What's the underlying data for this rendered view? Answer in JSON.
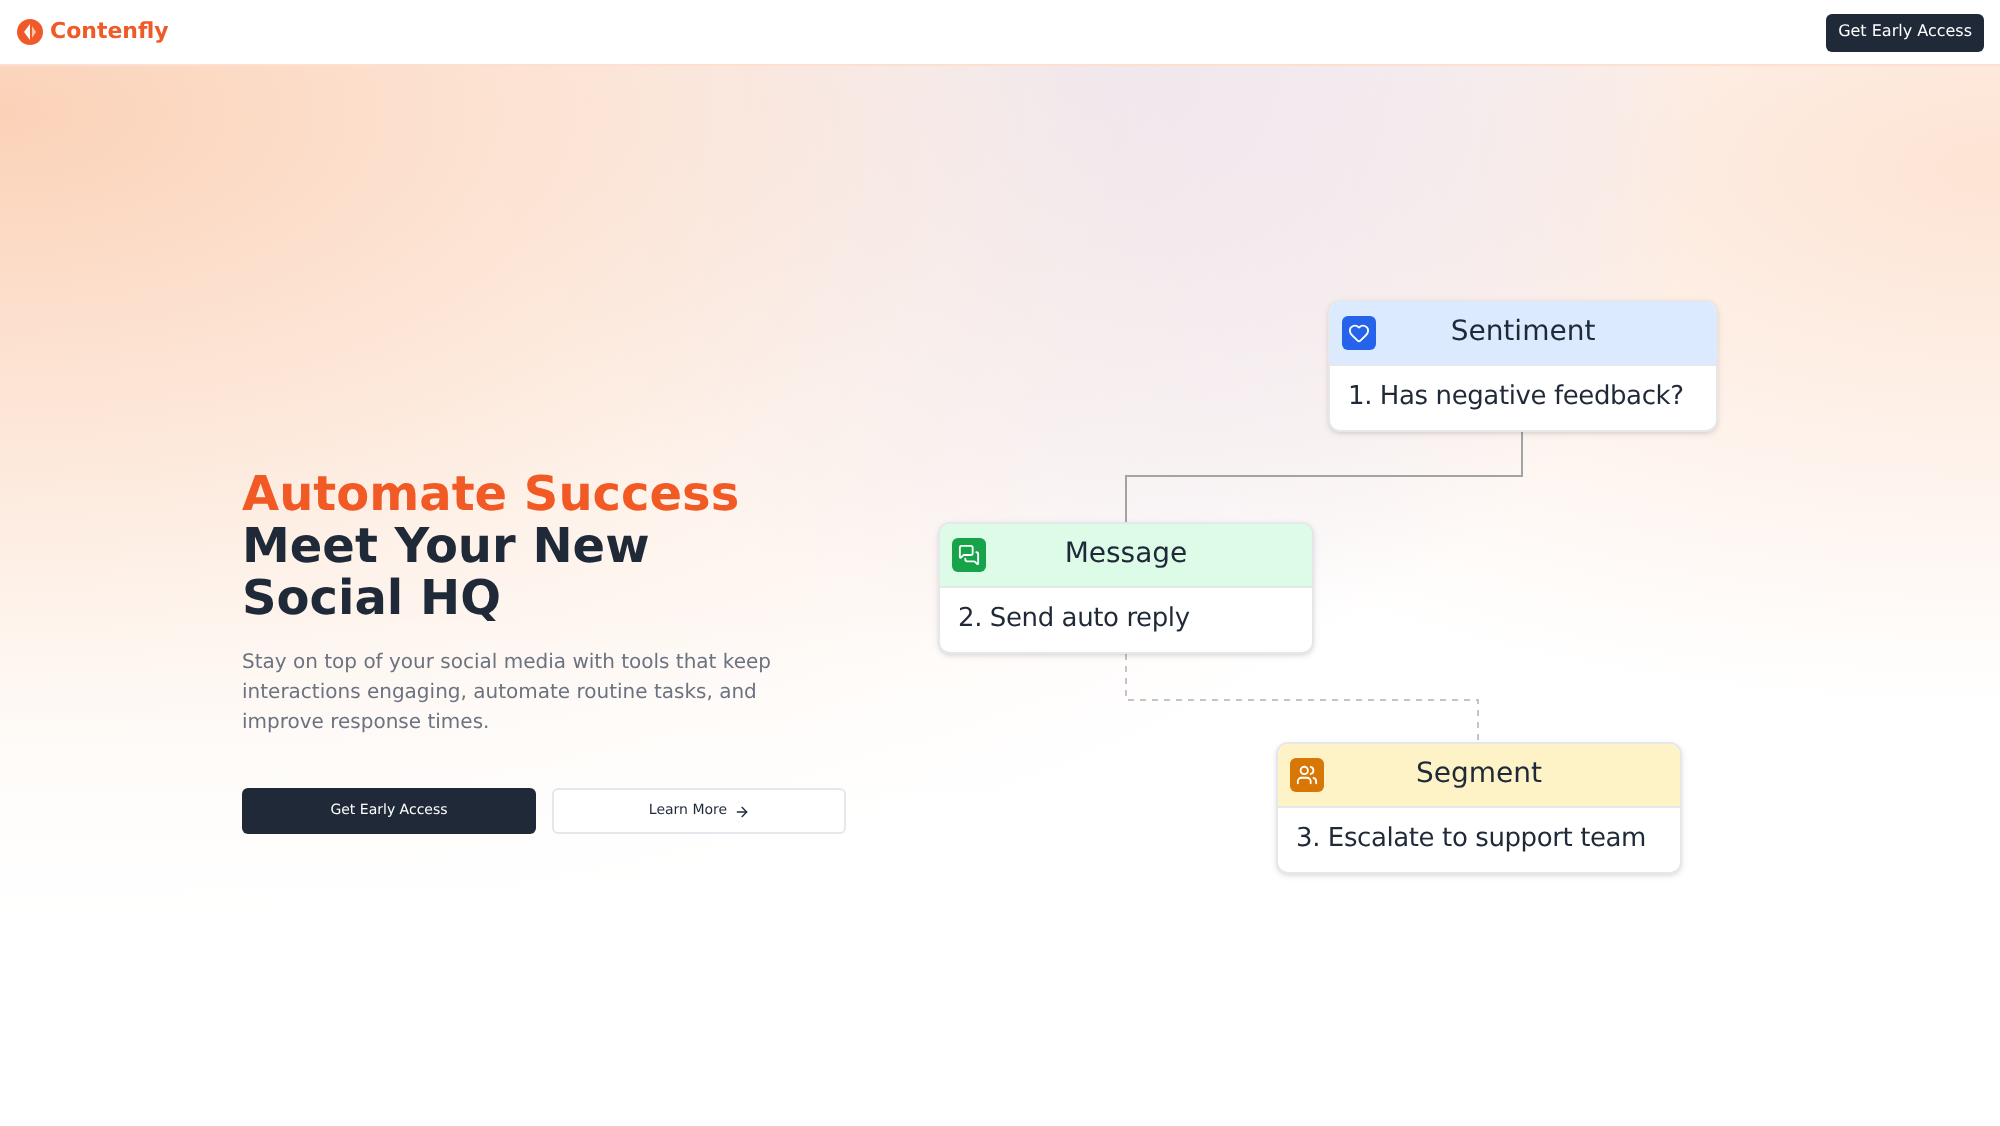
{
  "brand": {
    "name": "Contenfly"
  },
  "header": {
    "cta": "Get Early Access"
  },
  "hero": {
    "accent": "Automate Success",
    "title": "Meet Your New Social HQ",
    "text": "Stay on top of your social media with tools that keep interactions engaging, automate routine tasks, and improve response times.",
    "primary": "Get Early Access",
    "secondary": "Learn More"
  },
  "flow": {
    "nodes": [
      {
        "kind": "sentiment",
        "title": "Sentiment",
        "step": "1. Has negative feedback?"
      },
      {
        "kind": "message",
        "title": "Message",
        "step": "2. Send auto reply"
      },
      {
        "kind": "segment",
        "title": "Segment",
        "step": "3. Escalate to support team"
      }
    ],
    "connectors": [
      {
        "kind": "solid"
      },
      {
        "kind": "dashed"
      }
    ]
  }
}
